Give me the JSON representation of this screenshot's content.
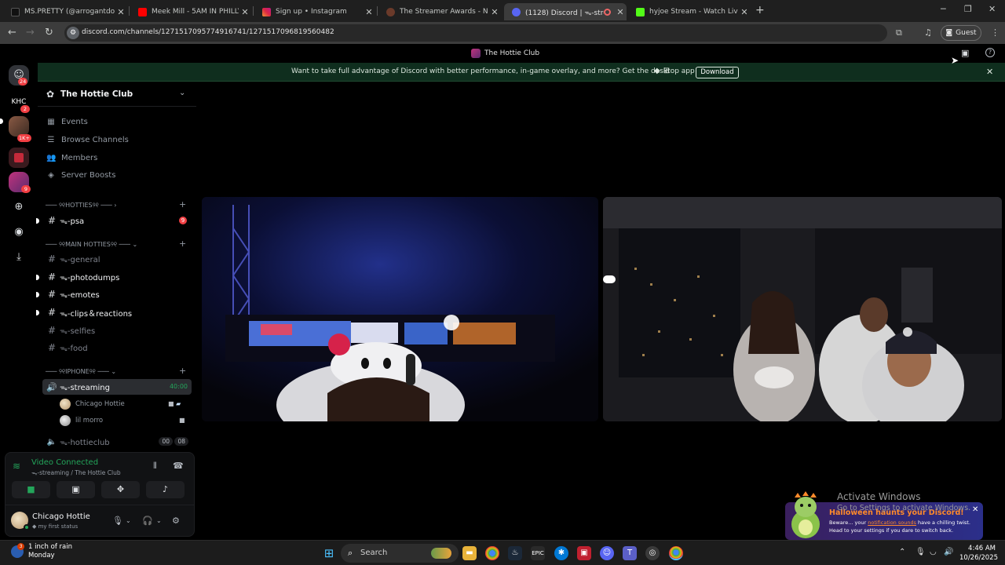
{
  "browser": {
    "tabs": [
      {
        "title": "MS.PRETTY (@arrogantdoll) | Ti",
        "favicon_color": "#111111"
      },
      {
        "title": "Meek Mill - 5AM IN PHILLY (OF",
        "favicon_color": "#ff0000"
      },
      {
        "title": "Sign up • Instagram",
        "favicon_color": "#d6249f"
      },
      {
        "title": "The Streamer Awards - Nomina",
        "favicon_color": "#6a3a2a"
      },
      {
        "title": "(1128) Discord | ᯓ-streamin",
        "favicon_color": "#5865f2",
        "active": true
      },
      {
        "title": "hyjoe Stream - Watch Live on K",
        "favicon_color": "#53fc18"
      }
    ],
    "new_tab_label": "+",
    "url": "discord.com/channels/1271517095774916741/1271517096819560482",
    "profile_label": "Guest"
  },
  "discord": {
    "window_title": "The Hottie Club",
    "banner": {
      "text": "Want to take full advantage of Discord with better performance, in-game overlay, and more? Get the desktop app!",
      "platforms": "",
      "download_label": "Download",
      "close": "✕"
    },
    "rail": {
      "dm_badge": "24",
      "servers": [
        {
          "abbr": "KHC",
          "badge": "2"
        },
        {
          "abbr": "",
          "badge": "1K+"
        },
        {
          "abbr": "",
          "badge": ""
        },
        {
          "abbr": "",
          "badge": "9"
        }
      ]
    },
    "guild": {
      "name": "The Hottie Club",
      "nav": [
        {
          "label": "Events"
        },
        {
          "label": "Browse Channels"
        },
        {
          "label": "Members"
        },
        {
          "label": "Server Boosts"
        }
      ],
      "categories": [
        {
          "label": "─── ୨୧HOTTIES୨୧ ─── ›"
        },
        {
          "label": "─── ୨୧MAIN HOTTIES୨୧ ─── ⌄"
        },
        {
          "label": "─── ୨୧IPHONE୨୧ ─── ⌄"
        }
      ],
      "channels": [
        {
          "name": "ᯓ-psa",
          "mention": "9"
        },
        {
          "name": "ᯓ-general"
        },
        {
          "name": "ᯓ-photodumps"
        },
        {
          "name": "ᯓ-emotes"
        },
        {
          "name": "ᯓ-clips＆reactions"
        },
        {
          "name": "ᯓ-selfies"
        },
        {
          "name": "ᯓ-food"
        },
        {
          "name": "ᯓ-streaming",
          "timer": "40:00"
        },
        {
          "name": "ᯓ-hottieclub",
          "pill_a": "00",
          "pill_b": "08"
        }
      ],
      "voice_users": [
        {
          "name": "Chicago Hottie"
        },
        {
          "name": "lil morro"
        }
      ]
    },
    "voice_panel": {
      "status": "Video Connected",
      "channel": "ᯓ-streaming / The Hottie Club"
    },
    "user_panel": {
      "name": "Chicago Hottie",
      "status": "my first status"
    },
    "toast": {
      "title": "Halloween haunts your Discord!",
      "body_1": "Beware... your ",
      "body_link": "notification sounds",
      "body_2": " have a chilling twist. Head to your settings if you dare to switch back."
    },
    "colors": {
      "accent_green": "#23a55a",
      "mention_red": "#f23f43",
      "toast_title": "#ff8a2b"
    }
  },
  "windows": {
    "watermark_title": "Activate Windows",
    "watermark_sub": "Go to Settings to activate Windows.",
    "weather_badge": "3",
    "weather_text_1": "1 inch of rain",
    "weather_text_2": "Monday",
    "search_label": "Search",
    "time": "4:46 AM",
    "date": "10/26/2025"
  }
}
